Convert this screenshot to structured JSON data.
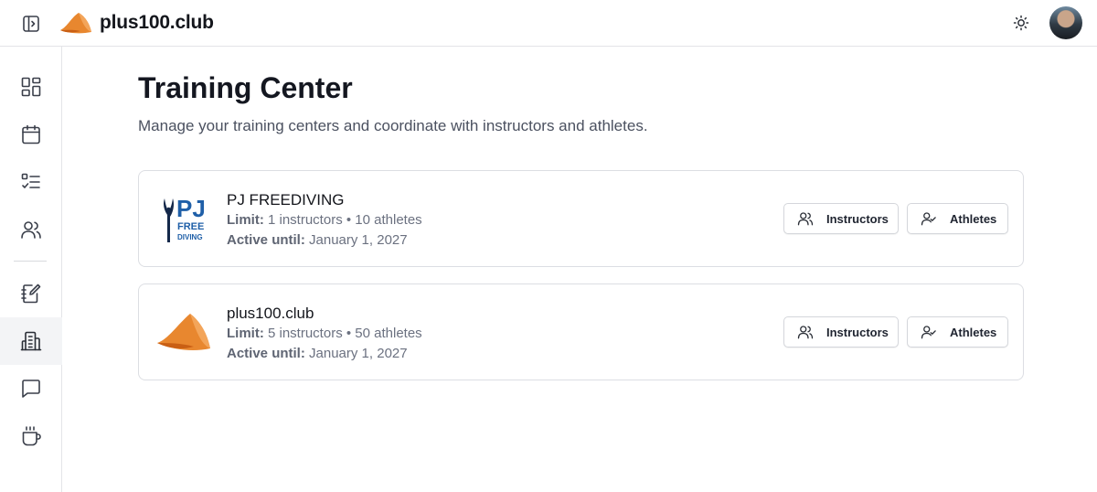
{
  "header": {
    "brand_name": "plus100.club",
    "toggle_icon": "sidebar-toggle-icon",
    "theme_icon": "sun-icon"
  },
  "sidebar": {
    "items": [
      {
        "icon": "dashboard-icon",
        "active": false
      },
      {
        "icon": "calendar-icon",
        "active": false
      },
      {
        "icon": "checklist-icon",
        "active": false
      },
      {
        "icon": "users-icon",
        "active": false
      },
      {
        "icon": "notebook-edit-icon",
        "active": false
      },
      {
        "icon": "building-icon",
        "active": true
      },
      {
        "icon": "message-icon",
        "active": false
      },
      {
        "icon": "coffee-icon",
        "active": false
      }
    ]
  },
  "page": {
    "title": "Training Center",
    "subtitle": "Manage your training centers and coordinate with instructors and athletes."
  },
  "centers": [
    {
      "name": "PJ FREEDIVING",
      "limit_label": "Limit:",
      "limit_value": " 1 instructors • 10 athletes",
      "active_label": "Active until:",
      "active_value": " January 1, 2027",
      "logo": {
        "line1": "PJ",
        "line2": "FREE",
        "line3": "DIVING"
      },
      "instructors_label": "Instructors",
      "athletes_label": "Athletes"
    },
    {
      "name": "plus100.club",
      "limit_label": "Limit:",
      "limit_value": " 5 instructors • 50 athletes",
      "active_label": "Active until:",
      "active_value": " January 1, 2027",
      "logo": {},
      "instructors_label": "Instructors",
      "athletes_label": "Athletes"
    }
  ],
  "colors": {
    "brand_orange": "#e8872f",
    "brand_orange_dark": "#d2691a",
    "pj_blue": "#1f5fa8"
  }
}
